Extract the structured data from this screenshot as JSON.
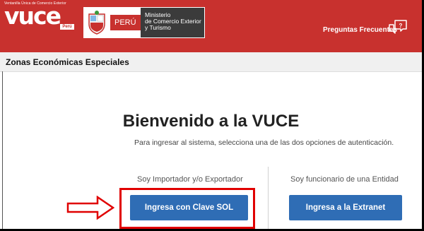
{
  "header": {
    "logo_tagline": "Ventanilla Única de Comercio Exterior",
    "logo_text": "vuce",
    "logo_country": "Perú",
    "gov_country": "PERÚ",
    "ministry": [
      "Ministerio",
      "de Comercio Exterior",
      "y Turismo"
    ],
    "faq_label": "Preguntas Frecuentes",
    "faq_icon": "faq-chat-icon"
  },
  "subbar": {
    "title": "Zonas Económicas Especiales"
  },
  "main": {
    "title": "Bienvenido a la VUCE",
    "subtitle": "Para ingresar al sistema, selecciona una de las dos opciones de autenticación.",
    "importer_label": "Soy Importador y/o Exportador",
    "importer_button": "Ingresa con Clave SOL",
    "official_label": "Soy funcionario de una Entidad",
    "official_button": "Ingresa a la Extranet"
  },
  "colors": {
    "header": "#c8312e",
    "button": "#2f6db5",
    "highlight": "#e00000"
  }
}
